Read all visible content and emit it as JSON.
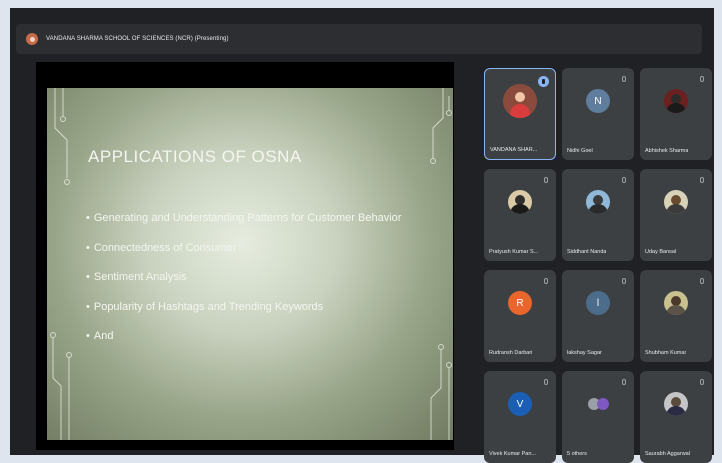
{
  "meeting": {
    "title": "VANDANA SHARMA SCHOOL OF SCIENCES (NCR) (Presenting)"
  },
  "slide": {
    "title": "APPLICATIONS OF OSNA",
    "bullets": [
      "Generating and Understanding Patterns for Customer Behavior",
      "Connectedness of Consumer",
      "Sentiment Analysis",
      "Popularity of Hashtags and Trending Keywords",
      "And"
    ]
  },
  "participants": [
    {
      "name": "VANDANA SHAR...",
      "speaking": true
    },
    {
      "name": "Nidhi Goel",
      "initial": "N"
    },
    {
      "name": "Abhishek Sharma"
    },
    {
      "name": "Pratyush Kumar S..."
    },
    {
      "name": "Siddhant Nanda"
    },
    {
      "name": "Uday Bansal"
    },
    {
      "name": "Rudransh Darbari",
      "initial": "R"
    },
    {
      "name": "lakshay Sagar",
      "initial": "l"
    },
    {
      "name": "Shubham Kumar"
    },
    {
      "name": "Vivek Kumar Pan...",
      "initial": "V"
    },
    {
      "name": "5 others"
    },
    {
      "name": "Saurabh Aggarwal"
    }
  ],
  "colors": {
    "background": "#202124",
    "tile": "#3c4043",
    "speaking": "#8ab4f8",
    "slide_gradient_center": "#e6ede0",
    "slide_gradient_edge": "#6f7a60"
  }
}
